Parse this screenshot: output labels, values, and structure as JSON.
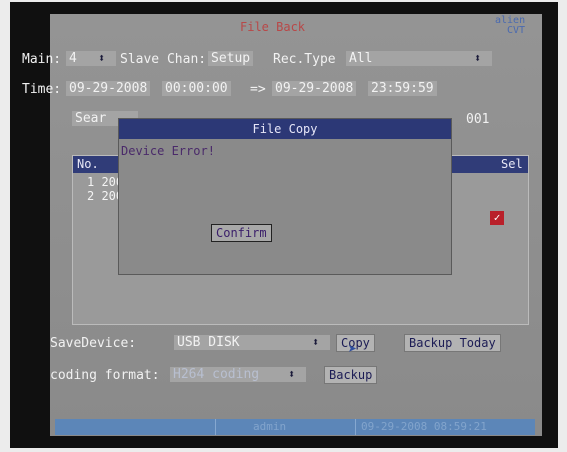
{
  "title": "File Back",
  "logo": "alien CVT",
  "main": {
    "label": "Main:",
    "value": "4"
  },
  "slave": {
    "label": "Slave Chan:",
    "value": "Setup"
  },
  "rectype": {
    "label": "Rec.Type",
    "value": "All"
  },
  "time": {
    "label": "Time:",
    "start_date": "09-29-2008",
    "start_time": "00:00:00",
    "sep": "=>",
    "end_date": "09-29-2008",
    "end_time": "23:59:59"
  },
  "search": {
    "label": "Sear",
    "trailing": "001"
  },
  "list": {
    "col_no": "No.",
    "col_sel": "Sel",
    "rows": [
      "1 200",
      "2 200"
    ]
  },
  "dialog": {
    "title": "File Copy",
    "message": "Device Error!",
    "confirm": "Confirm"
  },
  "save_device": {
    "label": "SaveDevice:",
    "value": "USB DISK"
  },
  "buttons": {
    "copy": "Copy",
    "backup_today": "Backup Today",
    "backup": "Backup"
  },
  "coding": {
    "label": "coding format:",
    "value": "H264 coding"
  },
  "status": {
    "user": "admin",
    "datetime": "09-29-2008 08:59:21"
  }
}
